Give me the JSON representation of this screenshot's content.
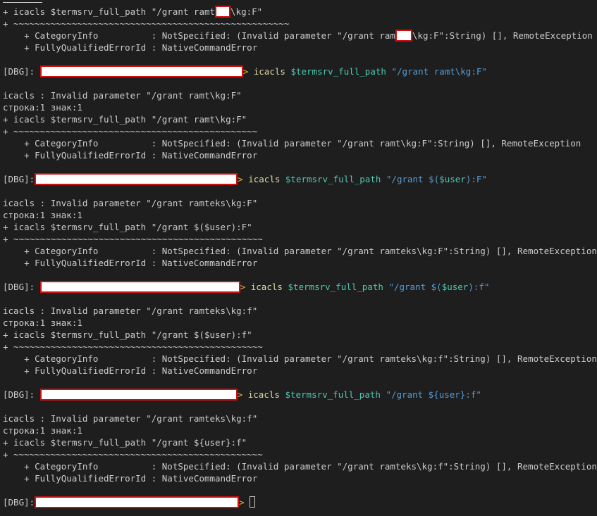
{
  "colors": {
    "background": "#1e1e1e",
    "text": "#cccccc",
    "command": "#dcdcaa",
    "variable": "#4ec9b0",
    "string": "#569cd6",
    "redaction_border": "#cc1111"
  },
  "terminal": {
    "l1a": "+ icacls $termsrv_full_path \"/grant ramt",
    "l1b": "\\kg:F\"",
    "l2": "+ ~~~~~~~~~~~~~~~~~~~~~~~~~~~~~~~~~~~~~~~~~~~~~~~~~~~~",
    "l3a": "    + CategoryInfo          : NotSpecified: (Invalid parameter \"/grant ram",
    "l3b": "\\kg:F\":String) [], RemoteException",
    "l4": "    + FullyQualifiedErrorId : NativeCommandError",
    "dbg1_label": "[DBG]: ",
    "dbg1_arrow": ">",
    "dbg1_cmd": "icacls",
    "dbg1_var": "$termsrv_full_path",
    "dbg1_str": "\"/grant ramt\\kg:F\"",
    "e1_1": "icacls : Invalid parameter \"/grant ramt\\kg:F\"",
    "e1_2": "строка:1 знак:1",
    "e1_3": "+ icacls $termsrv_full_path \"/grant ramt\\kg:F\"",
    "e1_4": "+ ~~~~~~~~~~~~~~~~~~~~~~~~~~~~~~~~~~~~~~~~~~~~~~",
    "e1_5": "    + CategoryInfo          : NotSpecified: (Invalid parameter \"/grant ramt\\kg:F\":String) [], RemoteException",
    "e1_6": "    + FullyQualifiedErrorId : NativeCommandError",
    "dbg2_label": "[DBG]:",
    "dbg2_arrow": ">",
    "dbg2_cmd": "icacls",
    "dbg2_var": "$termsrv_full_path",
    "dbg2_str1": "\"/grant $(",
    "dbg2_var2": "$user",
    "dbg2_str2": "):F\"",
    "e2_1": "icacls : Invalid parameter \"/grant ramteks\\kg:F\"",
    "e2_2": "строка:1 знак:1",
    "e2_3": "+ icacls $termsrv_full_path \"/grant $($user):F\"",
    "e2_4": "+ ~~~~~~~~~~~~~~~~~~~~~~~~~~~~~~~~~~~~~~~~~~~~~~~",
    "e2_5": "    + CategoryInfo          : NotSpecified: (Invalid parameter \"/grant ramteks\\kg:F\":String) [], RemoteException",
    "e2_6": "    + FullyQualifiedErrorId : NativeCommandError",
    "dbg3_label": "[DBG]: ",
    "dbg3_arrow": ">",
    "dbg3_cmd": "icacls",
    "dbg3_var": "$termsrv_full_path",
    "dbg3_str1": "\"/grant $(",
    "dbg3_var2": "$user",
    "dbg3_str2": "):f\"",
    "e3_1": "icacls : Invalid parameter \"/grant ramteks\\kg:f\"",
    "e3_2": "строка:1 знак:1",
    "e3_3": "+ icacls $termsrv_full_path \"/grant $($user):f\"",
    "e3_4": "+ ~~~~~~~~~~~~~~~~~~~~~~~~~~~~~~~~~~~~~~~~~~~~~~~",
    "e3_5": "    + CategoryInfo          : NotSpecified: (Invalid parameter \"/grant ramteks\\kg:f\":String) [], RemoteException",
    "e3_6": "    + FullyQualifiedErrorId : NativeCommandError",
    "dbg4_label": "[DBG]: ",
    "dbg4_arrow": ">",
    "dbg4_cmd": "icacls",
    "dbg4_var": "$termsrv_full_path",
    "dbg4_str": "\"/grant ${user}:f\"",
    "e4_1": "icacls : Invalid parameter \"/grant ramteks\\kg:f\"",
    "e4_2": "строка:1 знак:1",
    "e4_3": "+ icacls $termsrv_full_path \"/grant ${user}:f\"",
    "e4_4": "+ ~~~~~~~~~~~~~~~~~~~~~~~~~~~~~~~~~~~~~~~~~~~~~~~",
    "e4_5": "    + CategoryInfo          : NotSpecified: (Invalid parameter \"/grant ramteks\\kg:f\":String) [], RemoteException",
    "e4_6": "    + FullyQualifiedErrorId : NativeCommandError",
    "dbg5_label": "[DBG]:",
    "dbg5_arrow": ">"
  }
}
